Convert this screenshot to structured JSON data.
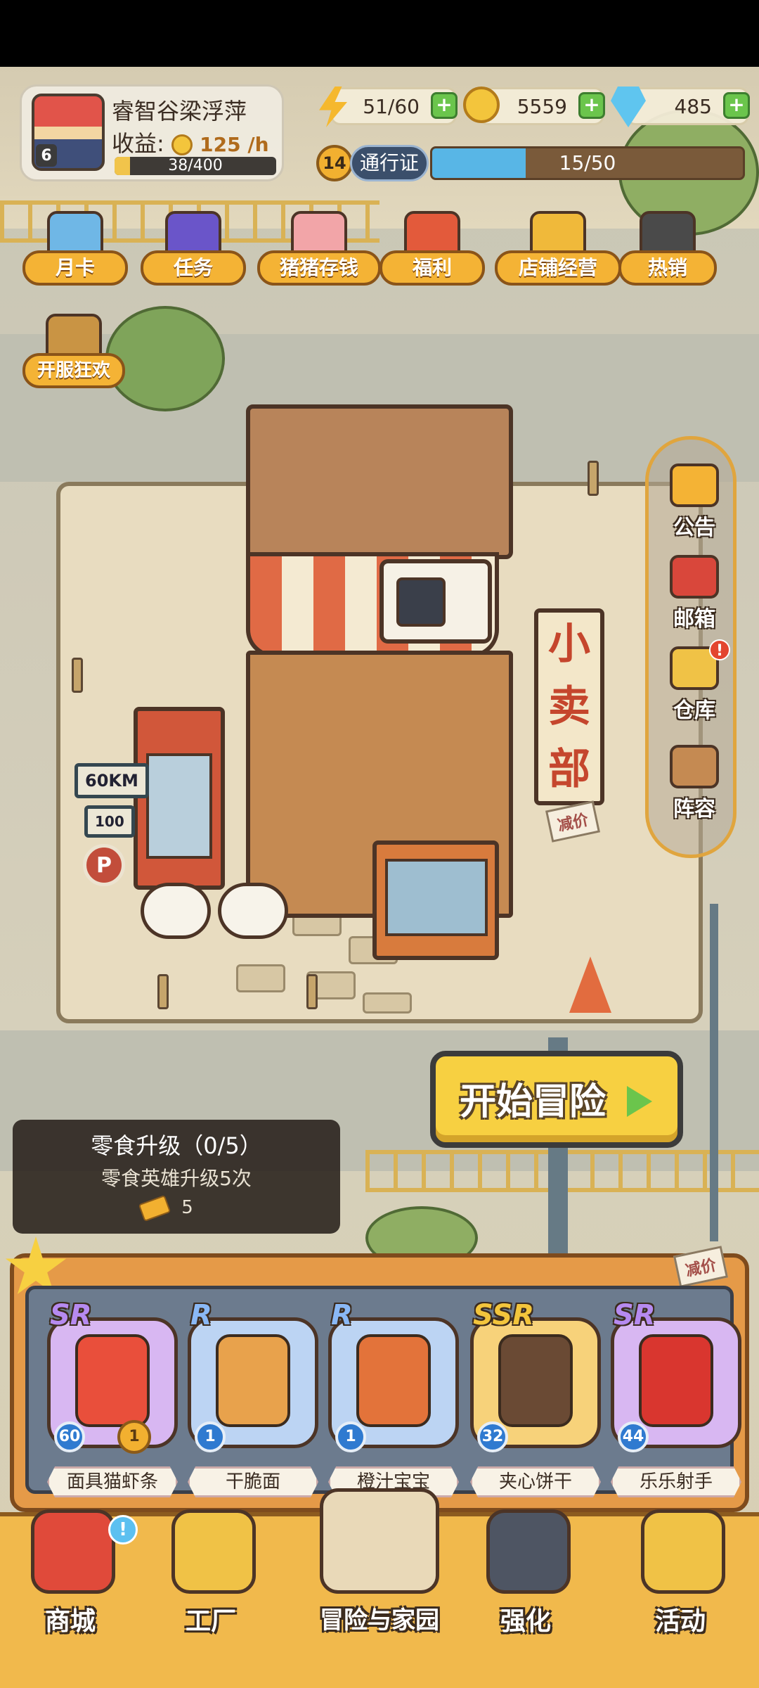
{
  "player": {
    "name": "睿智谷梁浮萍",
    "level": "6",
    "income_label": "收益:",
    "income_value": "125 /h",
    "xp_text": "38/400",
    "xp_progress": 0.095
  },
  "resources": {
    "energy": "51/60",
    "coins": "5559",
    "gems": "485",
    "plus": "+"
  },
  "pass": {
    "level": "14",
    "label": "通行证",
    "progress_text": "15/50",
    "progress": 0.3
  },
  "features": [
    {
      "label": "月卡",
      "icon": "month-card-icon",
      "color": "#6fb7e6"
    },
    {
      "label": "任务",
      "icon": "task-book-icon",
      "color": "#6a55c9"
    },
    {
      "label": "猪猪存钱",
      "icon": "piggy-bank-icon",
      "color": "#f2a5a8"
    },
    {
      "label": "福利",
      "icon": "gift-box-icon",
      "color": "#e35a3b"
    },
    {
      "label": "店铺经营",
      "icon": "shop-coin-icon",
      "color": "#f0b93a"
    },
    {
      "label": "热销",
      "icon": "sales-chart-icon",
      "color": "#4a4a4a"
    },
    {
      "label": "开服狂欢",
      "icon": "launch-bag-icon",
      "color": "#c99444"
    }
  ],
  "side_menu": [
    {
      "label": "公告",
      "icon": "megaphone-icon",
      "color": "#f4b335"
    },
    {
      "label": "邮箱",
      "icon": "mailbox-icon",
      "color": "#d9473b"
    },
    {
      "label": "仓库",
      "icon": "warehouse-icon",
      "color": "#f0c246",
      "badge": "!"
    },
    {
      "label": "阵容",
      "icon": "lineup-icon",
      "color": "#c58a52"
    }
  ],
  "scene": {
    "shop_sign": [
      "小",
      "卖",
      "部"
    ],
    "discount": "减价",
    "speed_sign": "60KM",
    "speed_sign2": "100",
    "parking": "P"
  },
  "start_button": {
    "label": "开始冒险"
  },
  "quest": {
    "title": "零食升级（0/5）",
    "description": "零食英雄升级5次",
    "reward": "5"
  },
  "heroes": [
    {
      "rarity": "SR",
      "rarity_color": "#b68af0",
      "name": "面具猫虾条",
      "level": "60",
      "stars": "1",
      "frame": "#d8b7f2",
      "figure": "#e94f3b"
    },
    {
      "rarity": "R",
      "rarity_color": "#8ab8f5",
      "name": "干脆面",
      "level": "1",
      "stars": "",
      "frame": "#bcd4f3",
      "figure": "#e8a24c"
    },
    {
      "rarity": "R",
      "rarity_color": "#8ab8f5",
      "name": "橙汁宝宝",
      "level": "1",
      "stars": "",
      "frame": "#bcd4f3",
      "figure": "#e3733a"
    },
    {
      "rarity": "SSR",
      "rarity_color": "#f3c53c",
      "name": "夹心饼干",
      "level": "32",
      "stars": "",
      "frame": "#f7d27a",
      "figure": "#6a4a34"
    },
    {
      "rarity": "SR",
      "rarity_color": "#b68af0",
      "name": "乐乐射手",
      "level": "44",
      "stars": "",
      "frame": "#d8b7f2",
      "figure": "#d9362f"
    }
  ],
  "hero_panel": {
    "discount": "减价"
  },
  "nav": [
    {
      "label": "商城",
      "icon": "shop-basket-icon",
      "color": "#e04a3a",
      "badge": "!"
    },
    {
      "label": "工厂",
      "icon": "factory-icon",
      "color": "#f0c246"
    },
    {
      "label": "冒险与家园",
      "icon": "adventure-home-icon",
      "color": "#e9d9b8",
      "active": true
    },
    {
      "label": "强化",
      "icon": "upgrade-robot-icon",
      "color": "#4e5563"
    },
    {
      "label": "活动",
      "icon": "event-trumpet-icon",
      "color": "#f0c246"
    }
  ],
  "colors": {
    "accent": "#f4b335",
    "panel_dark": "#28201a",
    "pass_fill": "#58b6e6",
    "plus_green": "#6bc54c"
  }
}
